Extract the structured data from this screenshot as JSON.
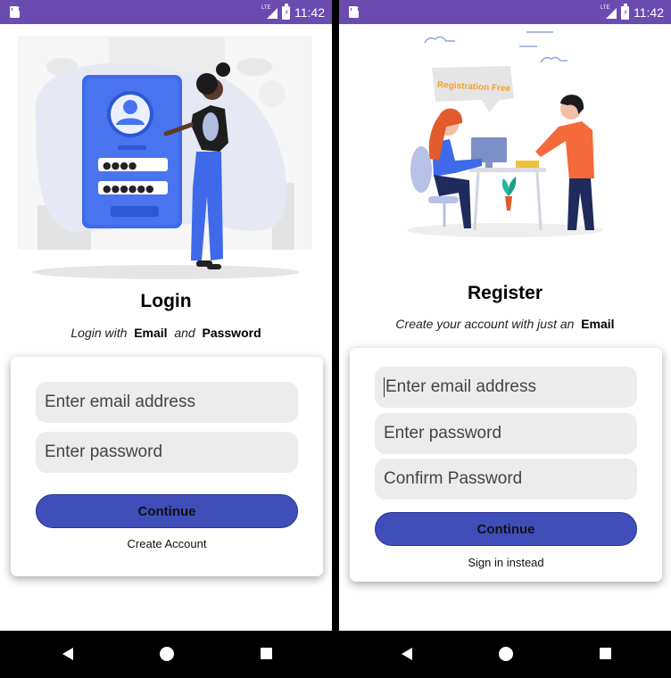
{
  "status_bar": {
    "time": "11:42",
    "network": "LTE"
  },
  "login": {
    "title": "Login",
    "subtitle": {
      "prefix": "Login with",
      "email": "Email",
      "and": "and",
      "password": "Password"
    },
    "email_placeholder": "Enter email address",
    "password_placeholder": "Enter password",
    "continue_label": "Continue",
    "create_account_label": "Create Account"
  },
  "register": {
    "illustration_banner": "Registration Free",
    "title": "Register",
    "subtitle": {
      "prefix": "Create your account with just an",
      "email": "Email"
    },
    "email_placeholder": "Enter email address",
    "password_placeholder": "Enter password",
    "confirm_placeholder": "Confirm Password",
    "continue_label": "Continue",
    "sign_in_label": "Sign in instead"
  },
  "colors": {
    "status_bar": "#6a4bb0",
    "primary_button": "#3f4eb8",
    "field_bg": "#ececec"
  },
  "icons": [
    "sd-card-icon",
    "lte-signal-icon",
    "battery-icon",
    "back-icon",
    "home-icon",
    "recents-icon"
  ]
}
